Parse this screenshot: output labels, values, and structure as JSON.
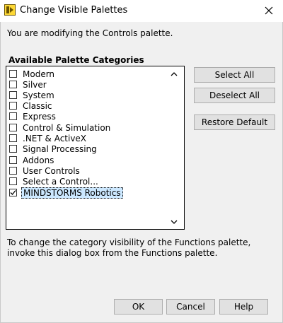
{
  "window": {
    "title": "Change Visible Palettes",
    "close_icon": "close-icon",
    "app_icon": "labview-icon"
  },
  "intro_text": "You are modifying the Controls palette.",
  "group_label": "Available Palette Categories",
  "categories": [
    {
      "label": "Modern",
      "checked": false
    },
    {
      "label": "Silver",
      "checked": false
    },
    {
      "label": "System",
      "checked": false
    },
    {
      "label": "Classic",
      "checked": false
    },
    {
      "label": "Express",
      "checked": false
    },
    {
      "label": "Control & Simulation",
      "checked": false
    },
    {
      "label": ".NET & ActiveX",
      "checked": false
    },
    {
      "label": "Signal Processing",
      "checked": false
    },
    {
      "label": "Addons",
      "checked": false
    },
    {
      "label": "User Controls",
      "checked": false
    },
    {
      "label": "Select a Control...",
      "checked": false
    },
    {
      "label": "MINDSTORMS Robotics",
      "checked": true,
      "selected": true
    }
  ],
  "buttons": {
    "select_all": "Select All",
    "deselect_all": "Deselect All",
    "restore_default": "Restore Default",
    "ok": "OK",
    "cancel": "Cancel",
    "help": "Help"
  },
  "footnote": "To change the category visibility of the Functions palette, invoke this dialog box from the Functions palette."
}
